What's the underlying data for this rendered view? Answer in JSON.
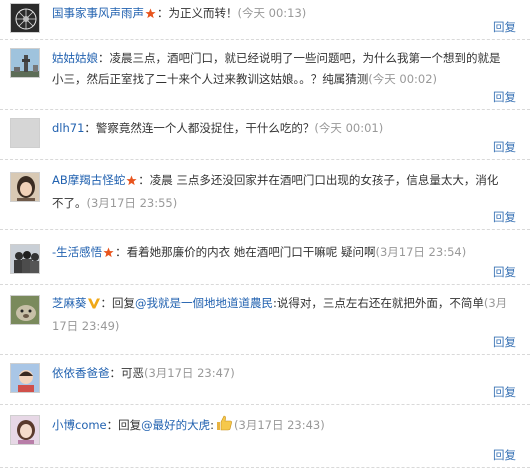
{
  "comments": [
    {
      "user": "国事家事风声雨声",
      "badge": "star",
      "text": "：为正义而转！",
      "time": "(今天 00:13)",
      "reply": "回复",
      "avatar": "dandelion"
    },
    {
      "user": "姑姑姑娘",
      "badge": "none",
      "text": "：凌晨三点，酒吧门口，就已经说明了一些问题吧，为什么我第一个想到的就是小三，然后正室找了二十来个人过来教训这姑娘。。？纯属猜测",
      "time": "(今天 00:02)",
      "reply": "回复",
      "avatar": "tower"
    },
    {
      "user": "dlh71",
      "badge": "none",
      "text": "：警察竟然连一个人都没捉住，干什么吃的？",
      "time": "(今天 00:01)",
      "reply": "回复",
      "avatar": "default"
    },
    {
      "user": "AB摩羯古怪蛇",
      "badge": "star",
      "text": "：凌晨 三点多还没回家并在酒吧门口出现的女孩子，信息量太大，消化不了。",
      "time": "(3月17日 23:55)",
      "reply": "回复",
      "avatar": "girl"
    },
    {
      "user": "-生活感悟",
      "badge": "star",
      "text": "：看着她那廉价的内衣 她在酒吧门口干嘛呢 疑问啊",
      "time": "(3月17日 23:54)",
      "reply": "回复",
      "avatar": "group"
    },
    {
      "user": "芝麻葵",
      "badge": "v",
      "text_before": "：回复",
      "mention": "@我就是一個地地道道農民",
      "text": ":说得对，三点左右还在就把外面，不简单",
      "time": "(3月17日 23:49)",
      "reply": "回复",
      "avatar": "animal"
    },
    {
      "user": "依依香爸爸",
      "badge": "none",
      "text": "：可恶",
      "time": "(3月17日 23:47)",
      "reply": "回复",
      "avatar": "kid"
    },
    {
      "user": "小博come",
      "badge": "none",
      "text_before": "：回复",
      "mention": "@最好的大虎",
      "text": ":",
      "emoji": "thumbs-up",
      "time": "(3月17日 23:43)",
      "reply": "回复",
      "avatar": "lady"
    }
  ],
  "colors": {
    "link": "#2262b0",
    "time": "#999999",
    "star": "#e8541d",
    "vip": "#f0a818"
  }
}
